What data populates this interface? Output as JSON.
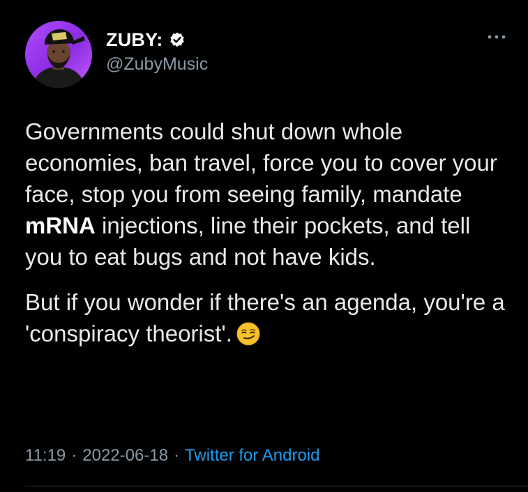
{
  "author": {
    "display_name": "ZUBY:",
    "handle": "@ZubyMusic",
    "verified": true,
    "avatar_icon": "avatar-icon"
  },
  "tweet": {
    "paragraph1": {
      "before_bold": "Governments could shut down whole economies, ban travel, force you to cover your face, stop you from seeing family, mandate ",
      "bold": "mRNA",
      "after_bold": " injections, line their pockets, and tell you to eat bugs and not have kids."
    },
    "paragraph2": {
      "text": "But if you wonder if there's an agenda, you're a 'conspiracy theorist'.",
      "emoji": "smirking-face-emoji"
    }
  },
  "meta": {
    "time": "11:19",
    "separator": "·",
    "date": "2022-06-18",
    "source": "Twitter for Android"
  },
  "colors": {
    "background": "#000000",
    "text": "#e7e9ea",
    "secondary": "#8b98a5",
    "link": "#1d9bf0",
    "avatar_bg": "#8a2be2"
  }
}
